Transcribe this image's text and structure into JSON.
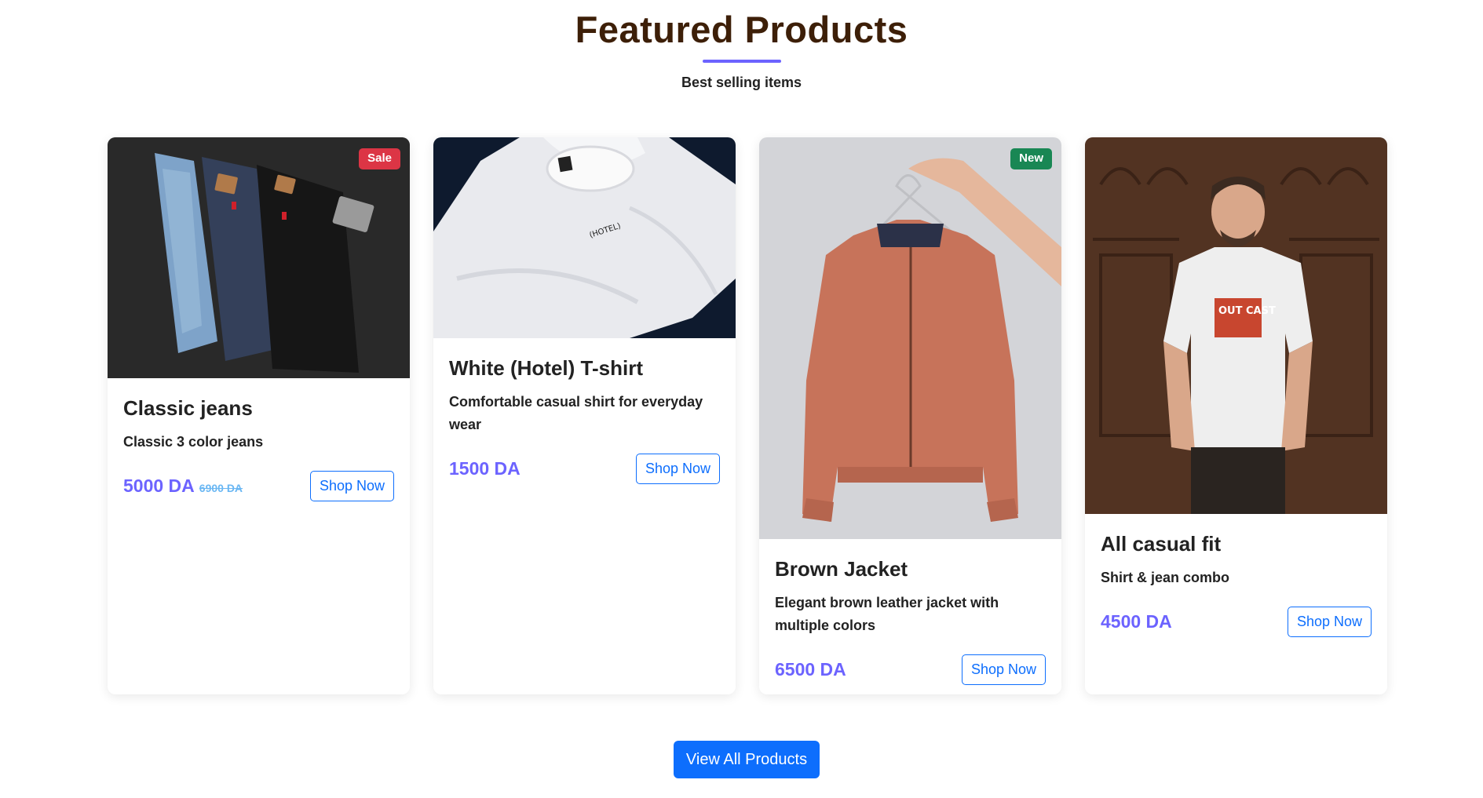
{
  "section": {
    "title": "Featured Products",
    "subtitle": "Best selling items"
  },
  "products": [
    {
      "title": "Classic jeans",
      "description": "Classic 3 color jeans",
      "price": "5000 DA",
      "old_price": "6900 DA",
      "badge": "Sale",
      "button": "Shop Now"
    },
    {
      "title": "White (Hotel) T-shirt",
      "description": "Comfortable casual shirt for everyday wear",
      "price": "1500 DA",
      "button": "Shop Now",
      "image_text": "(HOTEL)"
    },
    {
      "title": "Brown Jacket",
      "description": "Elegant brown leather jacket with multiple colors",
      "price": "6500 DA",
      "badge": "New",
      "button": "Shop Now"
    },
    {
      "title": "All casual fit",
      "description": "Shirt & jean combo",
      "price": "4500 DA",
      "button": "Shop Now",
      "image_text": "OUT CAST"
    }
  ],
  "cta": {
    "label": "View All Products"
  },
  "colors": {
    "accent": "#6c63ff",
    "primary": "#0d6efd",
    "sale_badge": "#dc3545",
    "new_badge": "#198754",
    "title": "#3d1f08"
  }
}
